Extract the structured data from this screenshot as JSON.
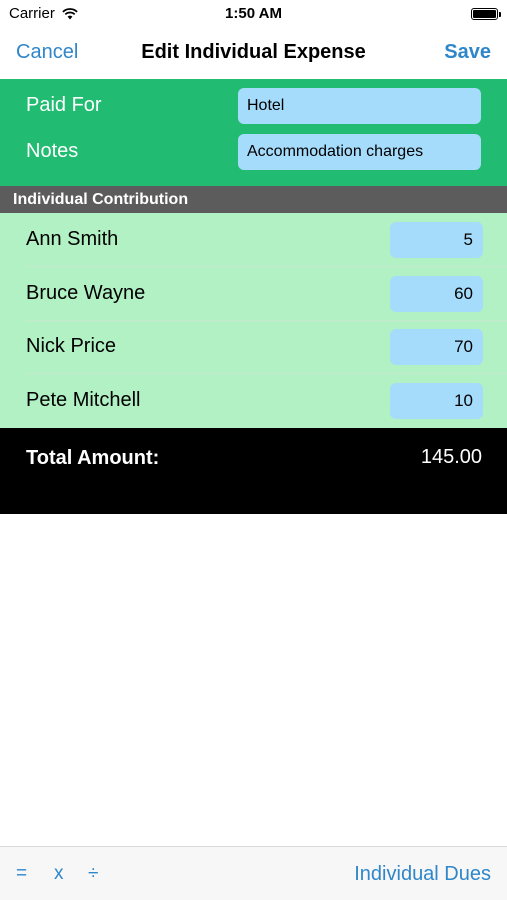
{
  "status_bar": {
    "carrier": "Carrier",
    "time": "1:50 AM"
  },
  "nav": {
    "cancel_label": "Cancel",
    "title": "Edit Individual Expense",
    "save_label": "Save"
  },
  "form": {
    "paid_for": {
      "label": "Paid For",
      "value": "Hotel"
    },
    "notes": {
      "label": "Notes",
      "value": "Accommodation charges"
    }
  },
  "contribution": {
    "header": "Individual Contribution",
    "people": [
      {
        "name": "Ann Smith",
        "amount": "5"
      },
      {
        "name": "Bruce Wayne",
        "amount": "60"
      },
      {
        "name": "Nick Price",
        "amount": "70"
      },
      {
        "name": "Pete Mitchell",
        "amount": "10"
      }
    ]
  },
  "total": {
    "label": "Total Amount:",
    "value": "145.00"
  },
  "toolbar": {
    "equals": "=",
    "multiply": "x",
    "divide": "÷",
    "dues_label": "Individual Dues"
  },
  "colors": {
    "accent": "#2f86c9",
    "form_bg": "#21bb72",
    "list_bg": "#b1f1c4",
    "field_bg": "#a6dcfb",
    "header_bg": "#5c5c5c"
  }
}
